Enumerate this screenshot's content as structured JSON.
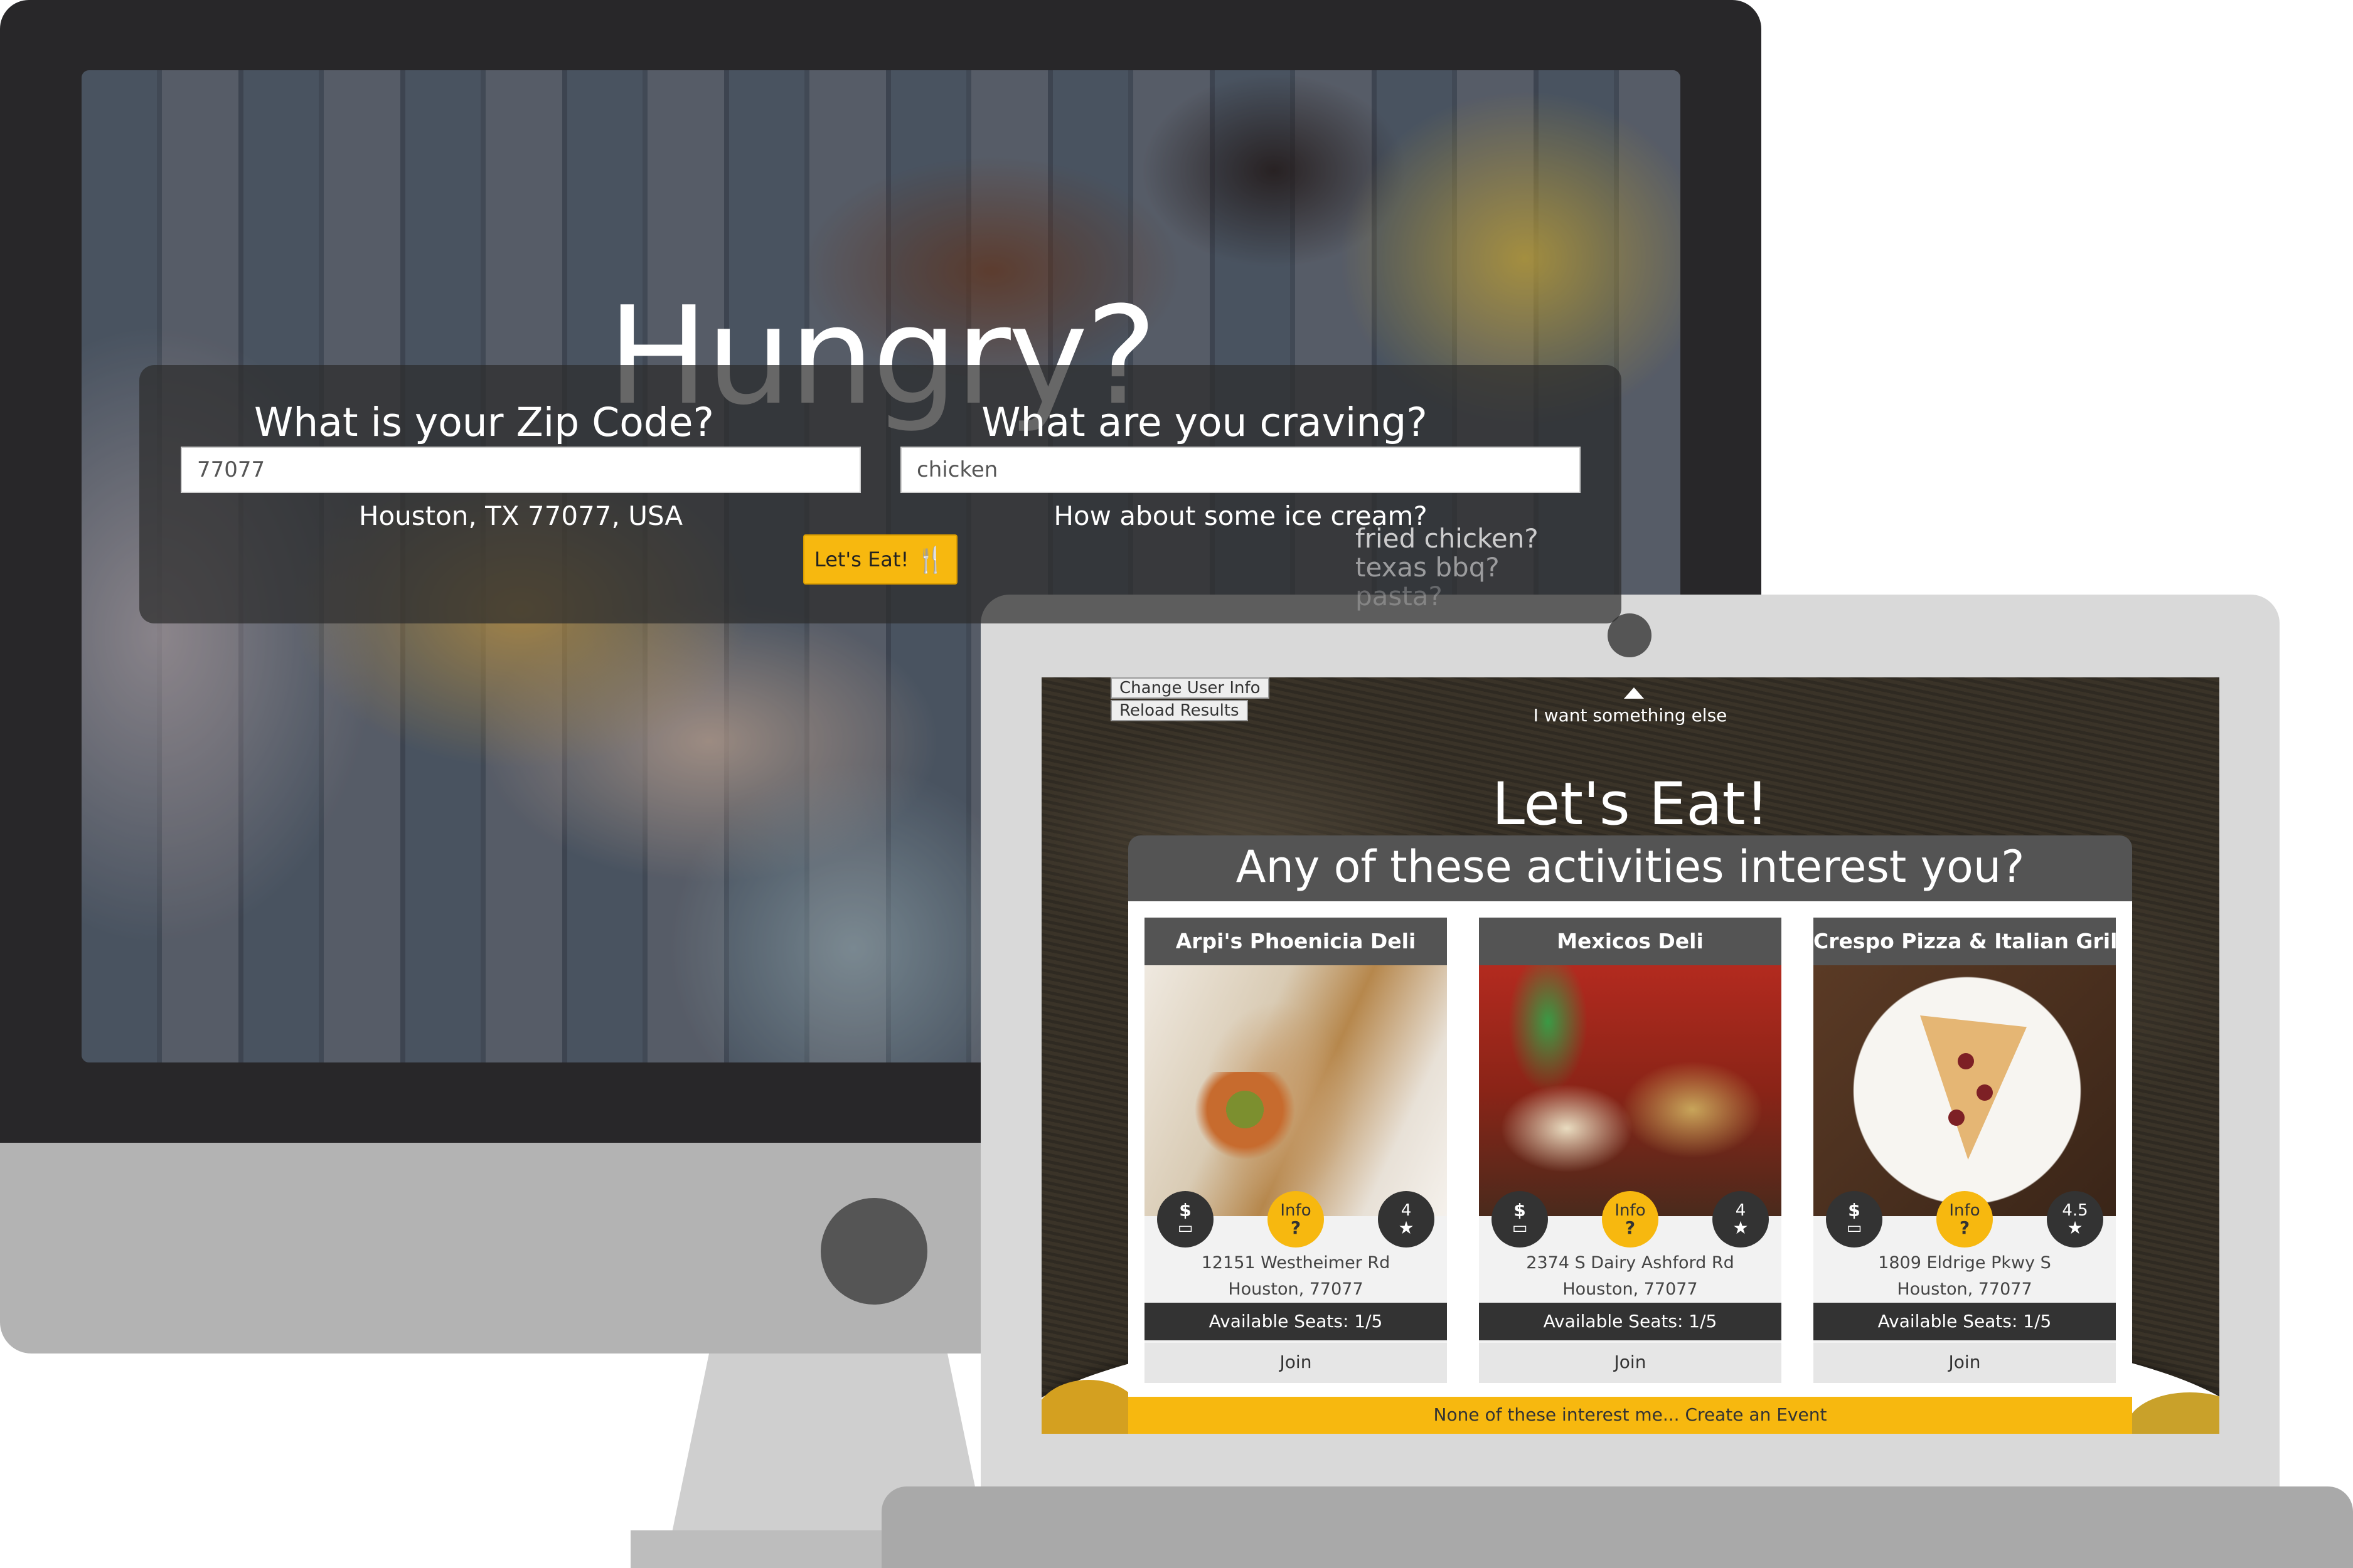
{
  "desktop": {
    "title": "Hungry?",
    "zip_label": "What is your Zip Code?",
    "zip_value": "77077",
    "zip_result": "Houston, TX 77077, USA",
    "craving_label": "What are you craving?",
    "craving_value": "chicken",
    "suggestion": "How about some ice cream?",
    "suggestion_list": [
      "fried chicken?",
      "texas bbq?",
      "pasta?"
    ],
    "eat_button": "Let's Eat!",
    "eat_icon": "utensils-icon"
  },
  "laptop": {
    "change_user_button": "Change User Info",
    "reload_button": "Reload Results",
    "want_else": "I want something else",
    "heading": "Let's Eat!",
    "panel_title": "Any of these activities interest you?",
    "create_event": "None of these interest me... Create an Event",
    "cards": [
      {
        "name": "Arpi's Phoenicia Deli",
        "price": "$",
        "info": "Info",
        "info_icon": "?",
        "rating": "4",
        "address_line1": "12151 Westheimer Rd",
        "address_line2": "Houston, 77077",
        "seats": "Available Seats: 1/5",
        "join": "Join"
      },
      {
        "name": "Mexicos Deli",
        "price": "$",
        "info": "Info",
        "info_icon": "?",
        "rating": "4",
        "address_line1": "2374 S Dairy Ashford Rd",
        "address_line2": "Houston, 77077",
        "seats": "Available Seats: 1/5",
        "join": "Join"
      },
      {
        "name": "Crespo Pizza & Italian Grill",
        "price": "$",
        "info": "Info",
        "info_icon": "?",
        "rating": "4.5",
        "address_line1": "1809 Eldrige Pkwy S",
        "address_line2": "Houston, 77077",
        "seats": "Available Seats: 1/5",
        "join": "Join"
      }
    ]
  },
  "colors": {
    "accent": "#f7b80f",
    "dark_panel": "#545454",
    "monitor_bezel": "#282729"
  }
}
